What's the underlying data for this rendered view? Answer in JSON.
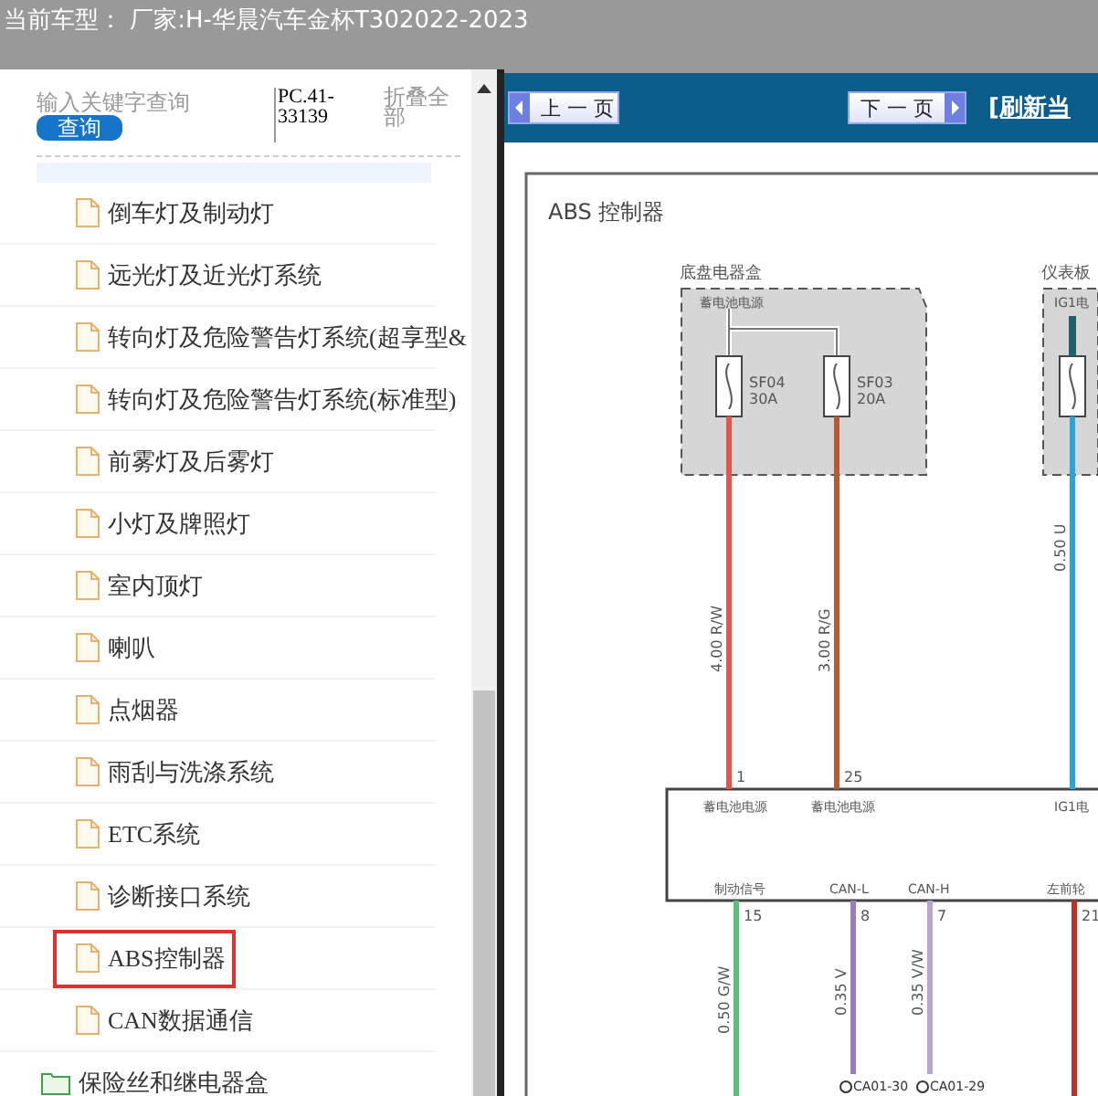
{
  "header": {
    "title": "当前车型：  厂家:H-华晨汽车金杯T302022-2023"
  },
  "sidebar": {
    "search": {
      "placeholder": "输入关键字查询",
      "button": "查询"
    },
    "code": "PC.41-33139",
    "collapse_all": "折叠全部",
    "tree": [
      {
        "kind": "file",
        "label": "倒车灯及制动灯",
        "selected": false
      },
      {
        "kind": "file",
        "label": "远光灯及近光灯系统",
        "selected": false
      },
      {
        "kind": "file",
        "label": "转向灯及危险警告灯系统(超享型&",
        "selected": false
      },
      {
        "kind": "file",
        "label": "转向灯及危险警告灯系统(标准型)",
        "selected": false
      },
      {
        "kind": "file",
        "label": "前雾灯及后雾灯",
        "selected": false
      },
      {
        "kind": "file",
        "label": "小灯及牌照灯",
        "selected": false
      },
      {
        "kind": "file",
        "label": "室内顶灯",
        "selected": false
      },
      {
        "kind": "file",
        "label": "喇叭",
        "selected": false
      },
      {
        "kind": "file",
        "label": "点烟器",
        "selected": false
      },
      {
        "kind": "file",
        "label": "雨刮与洗涤系统",
        "selected": false
      },
      {
        "kind": "file",
        "label": "ETC系统",
        "selected": false
      },
      {
        "kind": "file",
        "label": "诊断接口系统",
        "selected": false
      },
      {
        "kind": "file",
        "label": "ABS控制器",
        "selected": true
      },
      {
        "kind": "file",
        "label": "CAN数据通信",
        "selected": false
      },
      {
        "kind": "folder",
        "label": "保险丝和继电器盒",
        "selected": false
      }
    ]
  },
  "toolbar": {
    "prev": "上一页",
    "next": "下一页",
    "refresh": "[刷新当"
  },
  "diagram": {
    "title": "ABS 控制器",
    "boxes": [
      {
        "label": "底盘电器盒",
        "inner_label": "蓄电池电源"
      },
      {
        "label": "仪表板",
        "inner_label": "IG1电"
      }
    ],
    "fuses": [
      {
        "name": "SF04",
        "rating": "30A"
      },
      {
        "name": "SF03",
        "rating": "20A"
      }
    ],
    "top_pins": [
      {
        "pin": "1",
        "label": "蓄电池电源",
        "wire": "4.00 R/W",
        "color": "#e2564a"
      },
      {
        "pin": "25",
        "label": "蓄电池电源",
        "wire": "3.00 R/G",
        "color": "#b55a34"
      },
      {
        "label": "IG1电",
        "wire": "0.50 U",
        "color": "#2aa4dc"
      }
    ],
    "bottom_pins": [
      {
        "pin": "15",
        "label": "制动信号",
        "wire": "0.50 G/W",
        "color": "#5cbf80"
      },
      {
        "pin": "8",
        "label": "CAN-L",
        "wire": "0.35 V",
        "color": "#9a7cc4"
      },
      {
        "pin": "7",
        "label": "CAN-H",
        "wire": "0.35 V/W",
        "color": "#b9a2d6"
      },
      {
        "pin": "21",
        "label": "左前轮",
        "color": "#c0302a"
      }
    ],
    "connectors": [
      "CA01-30",
      "CA01-29"
    ]
  }
}
